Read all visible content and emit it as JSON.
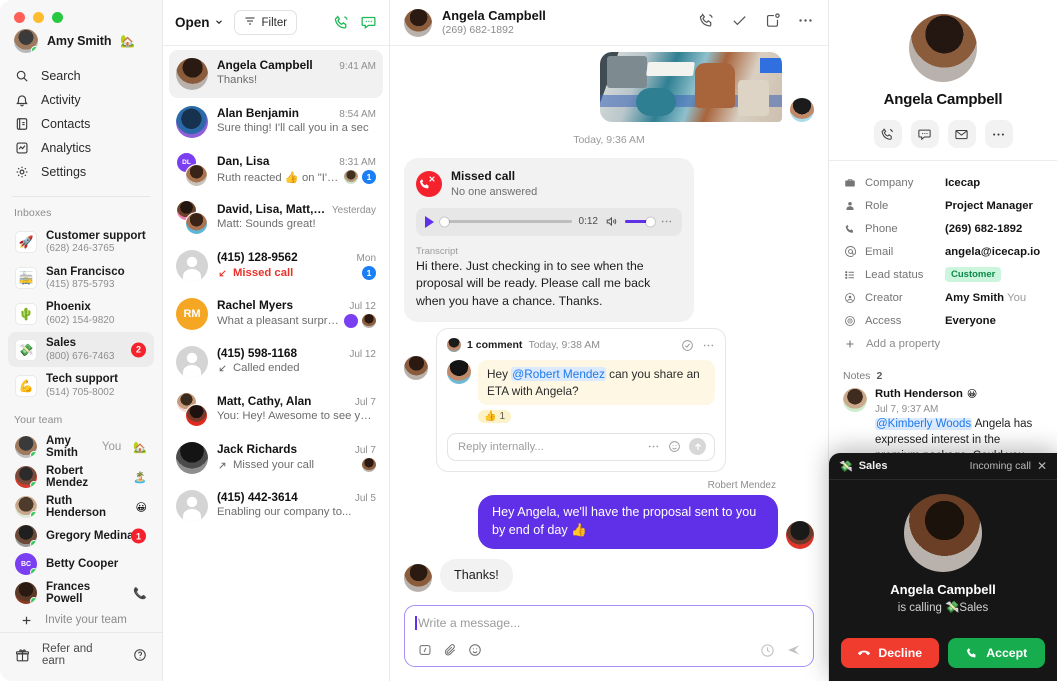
{
  "window": {
    "traffic_lights": [
      "close",
      "minimize",
      "zoom"
    ]
  },
  "nav": {
    "user": {
      "name": "Amy Smith",
      "emoji": "🏡"
    },
    "items": [
      {
        "label": "Search",
        "icon": "search-icon"
      },
      {
        "label": "Activity",
        "icon": "bell-icon"
      },
      {
        "label": "Contacts",
        "icon": "contacts-icon"
      },
      {
        "label": "Analytics",
        "icon": "analytics-icon"
      },
      {
        "label": "Settings",
        "icon": "gear-icon"
      }
    ],
    "inboxes_header": "Inboxes",
    "inboxes": [
      {
        "emoji": "🚀",
        "name": "Customer support",
        "number": "(628) 246-3765",
        "badge": ""
      },
      {
        "emoji": "🚋",
        "name": "San Francisco",
        "number": "(415) 875-5793",
        "badge": ""
      },
      {
        "emoji": "🌵",
        "name": "Phoenix",
        "number": "(602) 154-9820",
        "badge": ""
      },
      {
        "emoji": "💸",
        "name": "Sales",
        "number": "(800) 676-7463",
        "badge": "2"
      },
      {
        "emoji": "💪",
        "name": "Tech support",
        "number": "(514) 705-8002",
        "badge": ""
      }
    ],
    "team_header": "Your team",
    "team": [
      {
        "name": "Amy Smith",
        "you": "You",
        "emoji": "🏡",
        "badge": ""
      },
      {
        "name": "Robert Mendez",
        "you": "",
        "emoji": "🏝️",
        "badge": ""
      },
      {
        "name": "Ruth Henderson",
        "you": "",
        "emoji": "😀",
        "badge": ""
      },
      {
        "name": "Gregory Medina",
        "you": "",
        "emoji": "",
        "badge": "1"
      },
      {
        "name": "Betty Cooper",
        "you": "",
        "emoji": "",
        "badge": ""
      },
      {
        "name": "Frances Powell",
        "you": "",
        "emoji": "📞",
        "badge": ""
      }
    ],
    "invite_label": "Invite your team",
    "refer_label": "Refer and earn"
  },
  "conversations": {
    "filter_label": "Open",
    "filter_button": "Filter",
    "items": [
      {
        "name": "Angela Campbell",
        "time": "9:41 AM",
        "preview": "Thanks!",
        "selected": true,
        "type": "text",
        "badge": "",
        "avatar_kind": "photo-woman"
      },
      {
        "name": "Alan Benjamin",
        "time": "8:54 AM",
        "preview": "Sure thing! I'll call you in a sec",
        "selected": false,
        "type": "text",
        "badge": "",
        "avatar_kind": "photo-man-blue"
      },
      {
        "name": "Dan, Lisa",
        "time": "8:31 AM",
        "preview": "Ruth reacted 👍 on \"I'm...",
        "selected": false,
        "type": "group",
        "badge": "1",
        "avatar_kind": "group-dl"
      },
      {
        "name": "David, Lisa, Matt, Alan",
        "time": "Yesterday",
        "preview": "Matt: Sounds great!",
        "selected": false,
        "type": "group",
        "badge": "",
        "avatar_kind": "group-4"
      },
      {
        "name": "(415) 128-9562",
        "time": "Mon",
        "preview": "Missed call",
        "selected": false,
        "type": "missed",
        "badge": "1",
        "avatar_kind": "placeholder"
      },
      {
        "name": "Rachel Myers",
        "time": "Jul 12",
        "preview": "What a pleasant surprise!...",
        "selected": false,
        "type": "text",
        "badge": "",
        "avatar_kind": "initials-RM",
        "initials": "RM"
      },
      {
        "name": "(415) 598-1168",
        "time": "Jul 12",
        "preview": "Called ended",
        "selected": false,
        "type": "call",
        "badge": "",
        "avatar_kind": "placeholder"
      },
      {
        "name": "Matt, Cathy, Alan",
        "time": "Jul 7",
        "preview": "You: Hey! Awesome to see you...",
        "selected": false,
        "type": "group",
        "badge": "",
        "avatar_kind": "group-2"
      },
      {
        "name": "Jack Richards",
        "time": "Jul 7",
        "preview": "Missed your call",
        "selected": false,
        "type": "outgoing",
        "badge": "",
        "avatar_kind": "photo-man-hat"
      },
      {
        "name": "(415) 442-3614",
        "time": "Jul 5",
        "preview": "Enabling our company to...",
        "selected": false,
        "type": "text",
        "badge": "",
        "avatar_kind": "placeholder"
      }
    ]
  },
  "thread": {
    "header": {
      "name": "Angela Campbell",
      "number": "(269) 682-1892"
    },
    "daystamp": "Today, 9:36 AM",
    "missed_call": {
      "title": "Missed call",
      "subtitle": "No one answered",
      "duration": "0:12",
      "transcript_label": "Transcript",
      "transcript": "Hi there. Just checking in to see when the proposal will be ready. Please call me back when you have a chance. Thanks."
    },
    "comment": {
      "count_label": "1 comment",
      "time": "Today, 9:38 AM",
      "text_before": "Hey ",
      "mention": "@Robert Mendez",
      "text_after": " can you share an ETA with Angela?",
      "reaction_emoji": "👍",
      "reaction_count": "1",
      "reply_placeholder": "Reply internally..."
    },
    "outgoing": {
      "sender": "Robert Mendez",
      "text": "Hey Angela, we'll have the proposal sent to you by end of day 👍"
    },
    "incoming": {
      "text": "Thanks!"
    },
    "composer": {
      "placeholder": "Write a message..."
    }
  },
  "contact": {
    "name": "Angela Campbell",
    "actions": [
      "call-icon",
      "message-icon",
      "email-icon",
      "more-icon"
    ],
    "properties": [
      {
        "icon": "briefcase-icon",
        "key": "Company",
        "value": "Icecap",
        "kind": "text"
      },
      {
        "icon": "person-icon",
        "key": "Role",
        "value": "Project Manager",
        "kind": "text"
      },
      {
        "icon": "phone-icon",
        "key": "Phone",
        "value": "(269) 682-1892",
        "kind": "text"
      },
      {
        "icon": "at-icon",
        "key": "Email",
        "value": "angela@icecap.io",
        "kind": "text"
      },
      {
        "icon": "list-icon",
        "key": "Lead status",
        "value": "Customer",
        "kind": "chip"
      },
      {
        "icon": "creator-icon",
        "key": "Creator",
        "value": "Amy Smith",
        "sub": "You",
        "kind": "text"
      },
      {
        "icon": "eye-icon",
        "key": "Access",
        "value": "Everyone",
        "kind": "text"
      }
    ],
    "add_property_label": "Add a property",
    "notes_label": "Notes",
    "notes_count": "2",
    "notes": [
      {
        "author": "Ruth Henderson",
        "author_emoji": "😀",
        "time": "Jul 7, 9:37 AM",
        "mention": "@Kimberly Woods",
        "body": " Angela has expressed interest in the premium package. Could you get a quote together for her?"
      }
    ]
  },
  "incoming_call": {
    "inbox_emoji": "💸",
    "inbox_name": "Sales",
    "status": "Incoming call",
    "caller": "Angela Campbell",
    "calling_prefix": "is calling ",
    "calling_emoji": "💸",
    "calling_target": "Sales",
    "decline_label": "Decline",
    "accept_label": "Accept"
  },
  "colors": {
    "accent_purple": "#6030e8",
    "green": "#17ac4e",
    "red": "#f03c2e",
    "blue_badge": "#1a7ef5"
  }
}
